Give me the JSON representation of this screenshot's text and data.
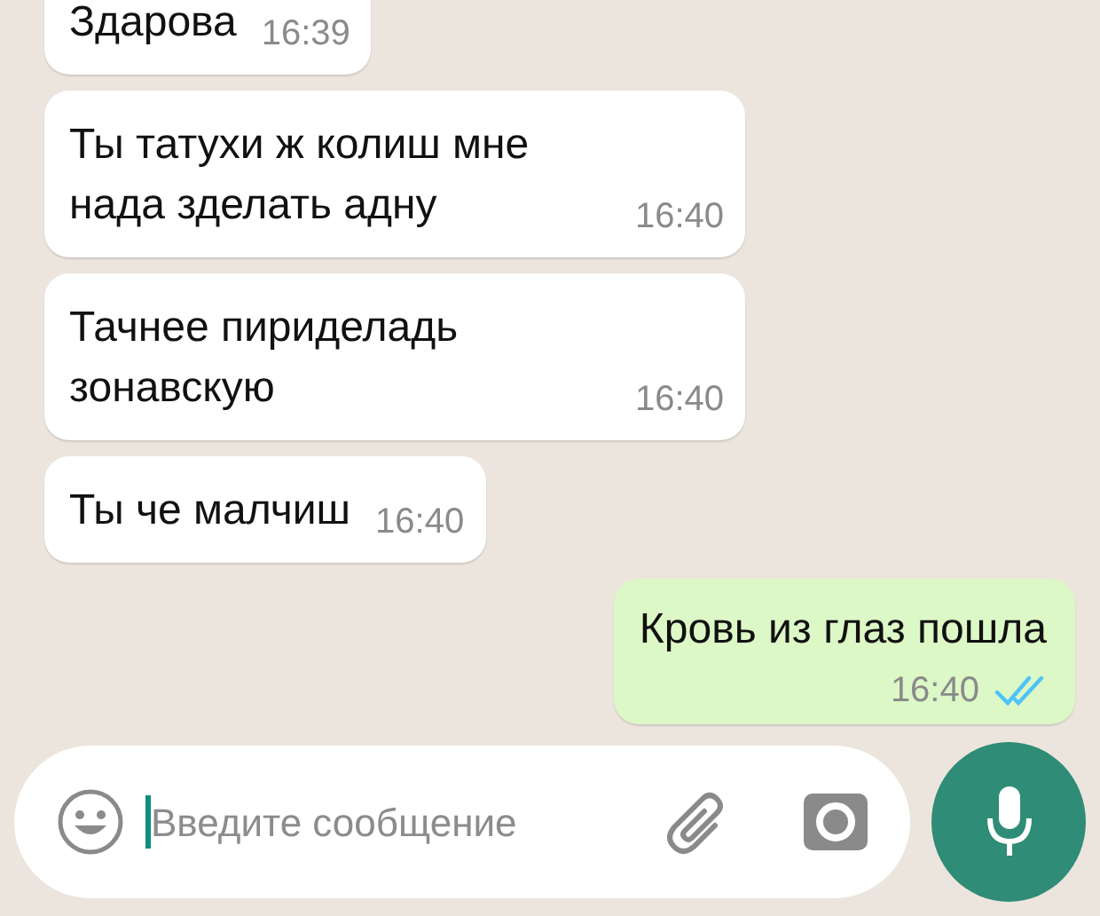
{
  "messages": [
    {
      "outgoing": false,
      "text": "Здарова",
      "time": "16:39"
    },
    {
      "outgoing": false,
      "text": "Ты татухи ж колиш мне нада зделать адну",
      "time": "16:40"
    },
    {
      "outgoing": false,
      "text": "Тачнее пириделадь зонавскую",
      "time": "16:40"
    },
    {
      "outgoing": false,
      "text": "Ты че малчиш",
      "time": "16:40"
    },
    {
      "outgoing": true,
      "text": "Кровь из глаз пошла",
      "time": "16:40",
      "read": true
    }
  ],
  "composer": {
    "placeholder": "Введите сообщение"
  }
}
